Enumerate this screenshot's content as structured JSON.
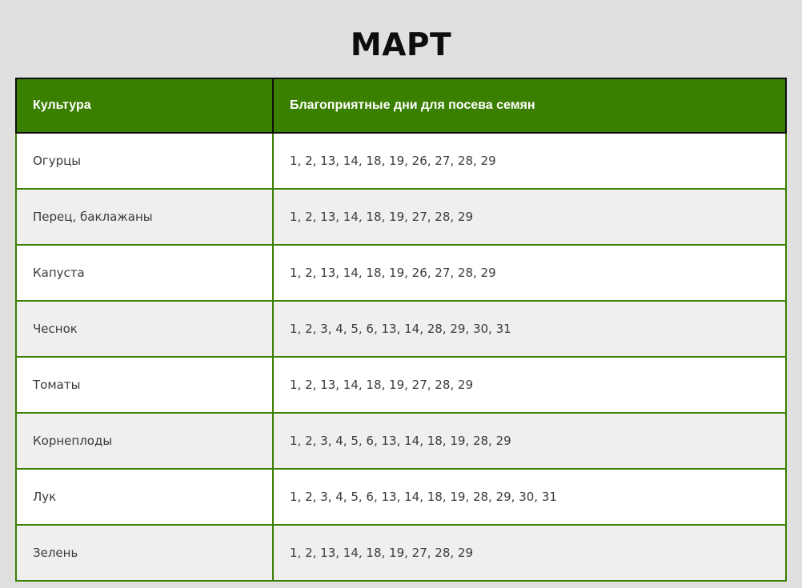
{
  "title": "МАРТ",
  "table": {
    "headers": {
      "crop": "Культура",
      "days": "Благоприятные дни для посева семян"
    },
    "rows": [
      {
        "crop": "Огурцы",
        "days": "1, 2, 13, 14, 18, 19, 26, 27, 28, 29"
      },
      {
        "crop": "Перец, баклажаны",
        "days": "1, 2, 13, 14, 18, 19, 27, 28, 29"
      },
      {
        "crop": "Капуста",
        "days": "1, 2, 13, 14, 18, 19, 26, 27, 28, 29"
      },
      {
        "crop": "Чеснок",
        "days": "1, 2, 3, 4, 5, 6, 13, 14, 28, 29, 30, 31"
      },
      {
        "crop": "Томаты",
        "days": "1, 2, 13, 14, 18, 19, 27, 28, 29"
      },
      {
        "crop": "Корнеплоды",
        "days": "1, 2, 3, 4, 5, 6, 13, 14, 18, 19, 28, 29"
      },
      {
        "crop": "Лук",
        "days": "1, 2, 3, 4, 5, 6, 13, 14, 18, 19, 28, 29, 30, 31"
      },
      {
        "crop": "Зелень",
        "days": "1, 2, 13, 14, 18, 19, 27, 28, 29"
      }
    ]
  },
  "colors": {
    "header_bg": "#3a7f00",
    "border": "#3a7f00",
    "row_alt": "#efefef",
    "page_bg": "#e0e0e0"
  }
}
